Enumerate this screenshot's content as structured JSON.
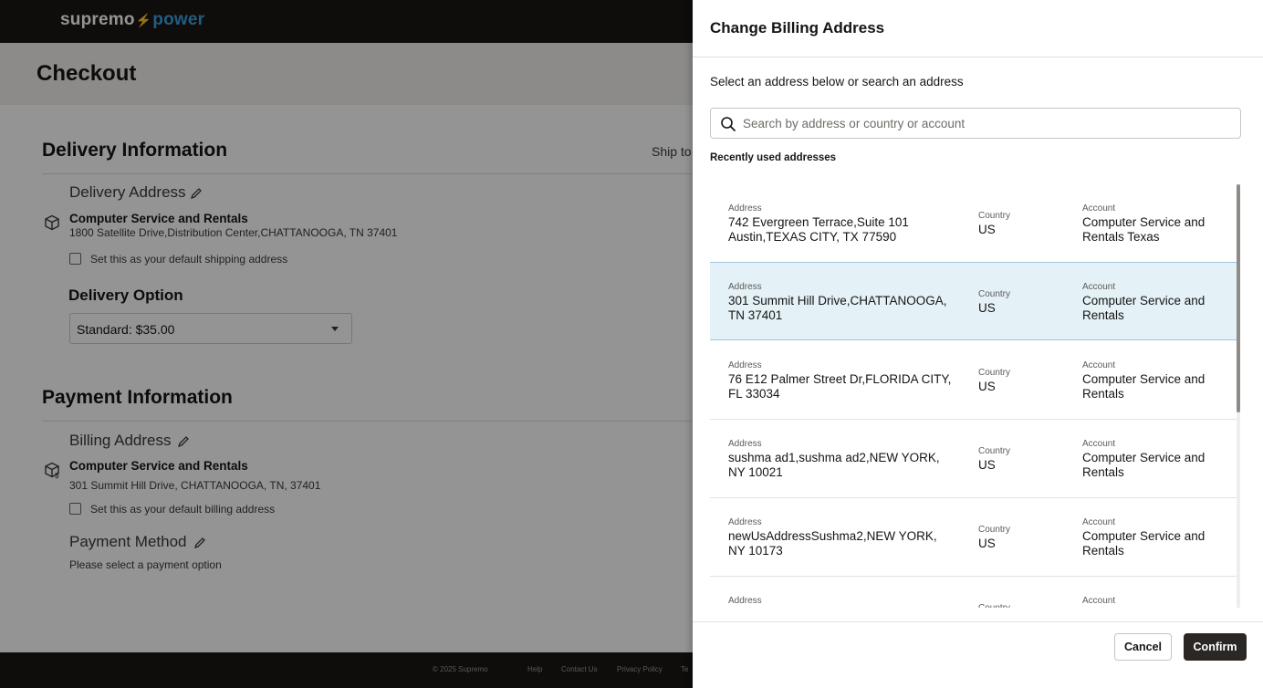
{
  "brand": {
    "logo_left": "supremo",
    "logo_bolt": "⚡",
    "logo_right": "power"
  },
  "page": {
    "title": "Checkout"
  },
  "delivery": {
    "section_title": "Delivery Information",
    "ship_to_label": "Ship to",
    "address_heading": "Delivery Address",
    "address_name": "Computer Service and Rentals",
    "address_line": "1800 Satellite Drive,Distribution Center,CHATTANOOGA, TN 37401",
    "default_checkbox_label": "Set this as your default shipping address",
    "option_heading": "Delivery Option",
    "option_value": "Standard: $35.00"
  },
  "payment": {
    "section_title": "Payment Information",
    "billing_heading": "Billing Address",
    "billing_name": "Computer Service and Rentals",
    "billing_line": "301 Summit Hill Drive, CHATTANOOGA, TN, 37401",
    "default_checkbox_label": "Set this as your default billing address",
    "method_heading": "Payment Method",
    "method_text": "Please select a payment option"
  },
  "footer": {
    "copyright": "© 2025 Supremo",
    "links": [
      "Help",
      "Contact Us",
      "Privacy Policy",
      "Te"
    ]
  },
  "drawer": {
    "title": "Change Billing Address",
    "subtitle": "Select an address below or search an address",
    "search_placeholder": "Search by address or country or account",
    "recent_label": "Recently used addresses",
    "column_labels": {
      "address": "Address",
      "country": "Country",
      "account": "Account"
    },
    "addresses": [
      {
        "address": "742 Evergreen Terrace,Suite 101 Austin,TEXAS CITY, TX 77590",
        "country": "US",
        "account": "Computer Service and Rentals Texas",
        "selected": false
      },
      {
        "address": "301 Summit Hill Drive,CHATTANOOGA, TN 37401",
        "country": "US",
        "account": "Computer Service and Rentals",
        "selected": true
      },
      {
        "address": "76 E12 Palmer Street Dr,FLORIDA CITY, FL 33034",
        "country": "US",
        "account": "Computer Service and Rentals",
        "selected": false
      },
      {
        "address": "sushma ad1,sushma ad2,NEW YORK, NY 10021",
        "country": "US",
        "account": "Computer Service and Rentals",
        "selected": false
      },
      {
        "address": "newUsAddressSushma2,NEW YORK, NY 10173",
        "country": "US",
        "account": "Computer Service and Rentals",
        "selected": false
      },
      {
        "address": "",
        "country": "",
        "account": "",
        "selected": false
      }
    ],
    "cancel_label": "Cancel",
    "confirm_label": "Confirm"
  },
  "colors": {
    "selected_row": "#e4f1f7",
    "overlay": "rgba(0,0,0,0.42)",
    "confirm_bg": "#2a2725",
    "brand_accent": "#3aa0e0"
  }
}
